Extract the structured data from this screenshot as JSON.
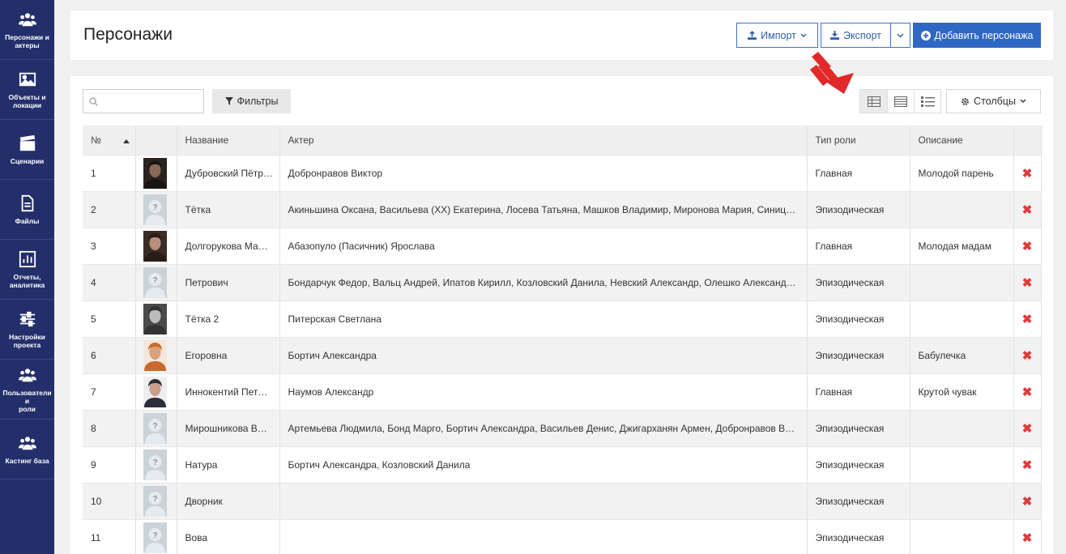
{
  "sidebar": {
    "items": [
      {
        "label": "Персонажи и\nактеры",
        "icon": "users-icon"
      },
      {
        "label": "Объекты и\nлокации",
        "icon": "image-icon"
      },
      {
        "label": "Сценарии",
        "icon": "clapperboard-icon"
      },
      {
        "label": "Файлы",
        "icon": "file-icon"
      },
      {
        "label": "Отчеты,\nаналитика",
        "icon": "bar-chart-icon"
      },
      {
        "label": "Настройки\nпроекта",
        "icon": "sliders-icon"
      },
      {
        "label": "Пользователи и\nроли",
        "icon": "users-icon"
      },
      {
        "label": "Кастинг база",
        "icon": "users-icon"
      }
    ]
  },
  "header": {
    "title": "Персонажи",
    "import_label": "Импорт",
    "export_label": "Экспорт",
    "add_label": "Добавить персонажа"
  },
  "toolbar": {
    "search_placeholder": "",
    "filters_label": "Фильтры",
    "columns_label": "Столбцы"
  },
  "table": {
    "headers": [
      "№",
      "",
      "Название",
      "Актер",
      "Тип роли",
      "Описание",
      ""
    ],
    "rows": [
      {
        "num": "1",
        "photo": "actor",
        "name": "Дубровский Пётр…",
        "actors": "Добронравов Виктор",
        "role": "Главная",
        "desc": "Молодой парень"
      },
      {
        "num": "2",
        "photo": "placeholder",
        "name": "Тётка",
        "actors": "Акиньшина Оксана, Васильева (ХХ) Екатерина, Лосева Татьяна, Машков Владимир, Миронова Мария, Синиц…",
        "role": "Эпизодическая",
        "desc": ""
      },
      {
        "num": "3",
        "photo": "actress",
        "name": "Долгорукова Ма…",
        "actors": "Абазопуло (Пасичник) Ярослава",
        "role": "Главная",
        "desc": "Молодая мадам"
      },
      {
        "num": "4",
        "photo": "placeholder",
        "name": "Петрович",
        "actors": "Бондарчук Федор, Вальц Андрей, Ипатов Кирилл, Козловский Данила, Невский Александр, Олешко Александ…",
        "role": "Эпизодическая",
        "desc": ""
      },
      {
        "num": "5",
        "photo": "bw",
        "name": "Тётка 2",
        "actors": "Питерская Светлана",
        "role": "Эпизодическая",
        "desc": ""
      },
      {
        "num": "6",
        "photo": "redhead",
        "name": "Егоровна",
        "actors": "Бортич Александра",
        "role": "Эпизодическая",
        "desc": "Бабулечка"
      },
      {
        "num": "7",
        "photo": "man",
        "name": "Иннокентий Пет…",
        "actors": "Наумов Александр",
        "role": "Главная",
        "desc": "Крутой чувак"
      },
      {
        "num": "8",
        "photo": "placeholder",
        "name": "Мирошникова В…",
        "actors": "Артемьева Людмила, Бонд Марго, Бортич Александра, Васильев Денис, Джигарханян Армен, Добронравов В…",
        "role": "Эпизодическая",
        "desc": ""
      },
      {
        "num": "9",
        "photo": "placeholder",
        "name": "Натура",
        "actors": "Бортич Александра, Козловский Данила",
        "role": "Эпизодическая",
        "desc": ""
      },
      {
        "num": "10",
        "photo": "placeholder",
        "name": "Дворник",
        "actors": "",
        "role": "Эпизодическая",
        "desc": ""
      },
      {
        "num": "11",
        "photo": "placeholder",
        "name": "Вова",
        "actors": "",
        "role": "Эпизодическая",
        "desc": ""
      }
    ],
    "delete_symbol": "✖"
  },
  "colors": {
    "sidebar_bg": "#232f6b",
    "primary": "#2f67c4",
    "delete": "#e03a3a",
    "arrow": "#e02a2a"
  }
}
